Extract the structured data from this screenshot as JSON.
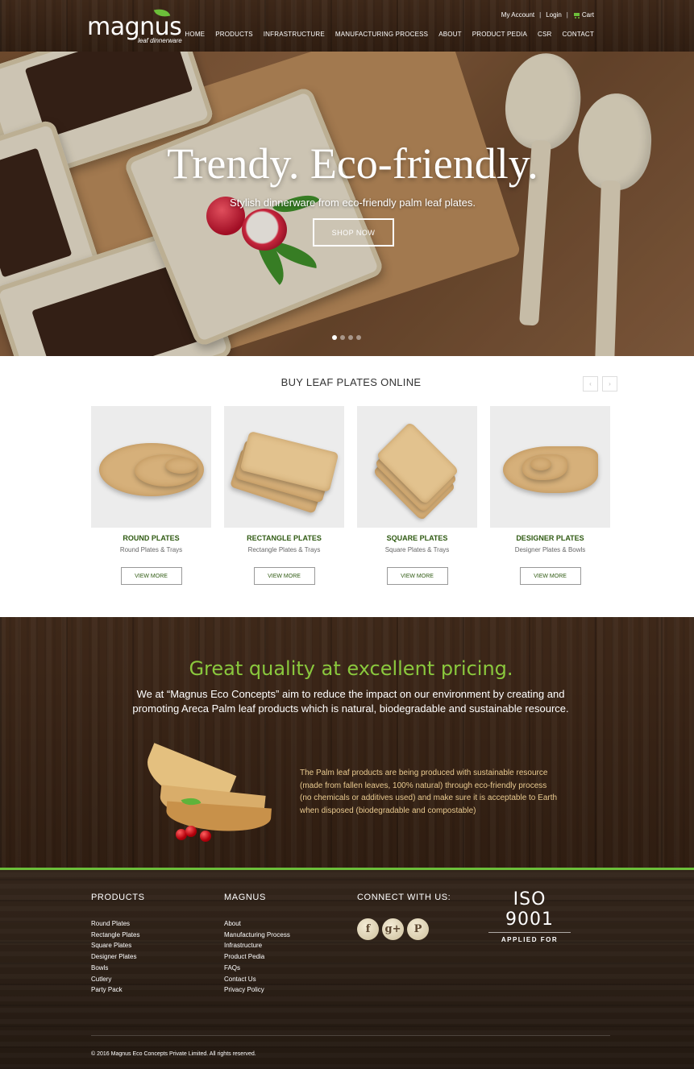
{
  "header": {
    "logo_text": "magnus",
    "logo_tagline": "leaf dinnerware",
    "account": {
      "my_account": "My Account",
      "login": "Login",
      "cart": "Cart",
      "separator": "|"
    },
    "nav": [
      "HOME",
      "PRODUCTS",
      "INFRASTRUCTURE",
      "MANUFACTURING PROCESS",
      "ABOUT",
      "PRODUCT PEDIA",
      "CSR",
      "CONTACT"
    ]
  },
  "hero": {
    "title": "Trendy. Eco-friendly.",
    "subtitle": "Stylish dinnerware from eco-friendly palm leaf plates.",
    "cta": "SHOP NOW",
    "slides": 4,
    "active_slide": 1
  },
  "products": {
    "heading": "BUY LEAF PLATES ONLINE",
    "prev_icon": "‹",
    "next_icon": "›",
    "items": [
      {
        "name": "ROUND PLATES",
        "sub": "Round Plates & Trays",
        "button": "VIEW MORE"
      },
      {
        "name": "RECTANGLE PLATES",
        "sub": "Rectangle Plates & Trays",
        "button": "VIEW MORE"
      },
      {
        "name": "SQUARE PLATES",
        "sub": "Square Plates & Trays",
        "button": "VIEW MORE"
      },
      {
        "name": "DESIGNER PLATES",
        "sub": "Designer Plates & Bowls",
        "button": "VIEW MORE"
      }
    ]
  },
  "quality": {
    "title": "Great quality at excellent pricing.",
    "lead": "We at “Magnus Eco Concepts” aim to reduce the impact on our environment by creating and promoting Areca Palm leaf products which is natural, biodegradable and sustainable resource.",
    "body": "The Palm leaf products are being produced with sustainable resource (made from fallen leaves, 100% natural) through eco-friendly process (no chemicals or additives used) and make sure it is acceptable to Earth when disposed (biodegradable and compostable)"
  },
  "footer": {
    "products_heading": "PRODUCTS",
    "products_links": [
      "Round Plates",
      "Rectangle Plates",
      "Square Plates",
      "Designer Plates",
      "Bowls",
      "Cutlery",
      "Party Pack"
    ],
    "magnus_heading": "MAGNUS",
    "magnus_links": [
      "About",
      "Manufacturing Process",
      "Infrastructure",
      "Product Pedia",
      "FAQs",
      "Contact Us",
      "Privacy Policy"
    ],
    "connect_heading": "CONNECT WITH US:",
    "social": [
      {
        "icon": "facebook-icon",
        "glyph": "f"
      },
      {
        "icon": "google-plus-icon",
        "glyph": "g+"
      },
      {
        "icon": "pinterest-icon",
        "glyph": "P"
      }
    ],
    "iso_main": "ISO 9001",
    "iso_sub": "APPLIED FOR",
    "copyright": "© 2016 Magnus Eco Concepts Private Limited. All rights reserved."
  },
  "colors": {
    "accent_green": "#6cbf3a",
    "title_green": "#8ac83d",
    "product_name": "#2f5a12"
  }
}
